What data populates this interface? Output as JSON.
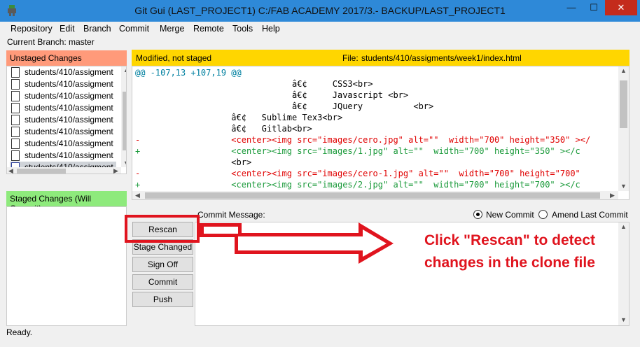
{
  "window": {
    "title": "Git Gui (LAST_PROJECT1) C:/FAB ACADEMY 2017/3.- BACKUP/LAST_PROJECT1",
    "minimize": "—",
    "maximize": "☐",
    "close": "✕",
    "icon": "git-gui-icon"
  },
  "menu": {
    "items": [
      "Repository",
      "Edit",
      "Branch",
      "Commit",
      "Merge",
      "Remote",
      "Tools",
      "Help"
    ]
  },
  "branch_line": "Current Branch: master",
  "unstaged": {
    "header": "Unstaged Changes",
    "header_color": "#ff9a7a",
    "files": [
      "students/410/assigment",
      "students/410/assigment",
      "students/410/assigment",
      "students/410/assigment",
      "students/410/assigment",
      "students/410/assigment",
      "students/410/assigment",
      "students/410/assigment",
      "students/410/assigment"
    ],
    "file_icon": "document-icon"
  },
  "staged": {
    "header": "Staged Changes (Will Commit)",
    "header_color": "#8eea7c"
  },
  "diff": {
    "status": "Modified, not staged",
    "file_label": "File:",
    "file_path": "students/410/assigments/week1/index.html",
    "header_color": "#ffd600",
    "lines": [
      {
        "type": "hunk",
        "text": "@@ -107,13 +107,19 @@"
      },
      {
        "type": "ctx",
        "text": "                               â€¢     CSS3<br>"
      },
      {
        "type": "ctx",
        "text": "                               â€¢     Javascript <br>"
      },
      {
        "type": "ctx",
        "text": "                               â€¢     JQuery          <br>"
      },
      {
        "type": "ctx",
        "text": "                   â€¢   Sublime Tex3<br>"
      },
      {
        "type": "ctx",
        "text": "                   â€¢   Gitlab<br>"
      },
      {
        "type": "del",
        "text": "-                  <center><img src=\"images/cero.jpg\" alt=\"\"  width=\"700\" height=\"350\" ></"
      },
      {
        "type": "add",
        "text": "+                  <center><img src=\"images/1.jpg\" alt=\"\"  width=\"700\" height=\"350\" ></c"
      },
      {
        "type": "ctx",
        "text": "                   <br>"
      },
      {
        "type": "del",
        "text": "-                  <center><img src=\"images/cero-1.jpg\" alt=\"\"  width=\"700\" height=\"700\""
      },
      {
        "type": "add",
        "text": "+                  <center><img src=\"images/2.jpg\" alt=\"\"  width=\"700\" height=\"700\" ></c"
      }
    ]
  },
  "commit": {
    "message_label": "Commit Message:",
    "new_commit": "New Commit",
    "amend": "Amend Last Commit",
    "selected_mode": "New Commit"
  },
  "buttons": {
    "rescan": "Rescan",
    "stage_changed": "Stage Changed",
    "sign_off": "Sign Off",
    "commit": "Commit",
    "push": "Push"
  },
  "annotation": {
    "text_line1": "Click \"Rescan\" to detect",
    "text_line2": "changes in the clone file",
    "color": "#e0141e"
  },
  "status": "Ready."
}
